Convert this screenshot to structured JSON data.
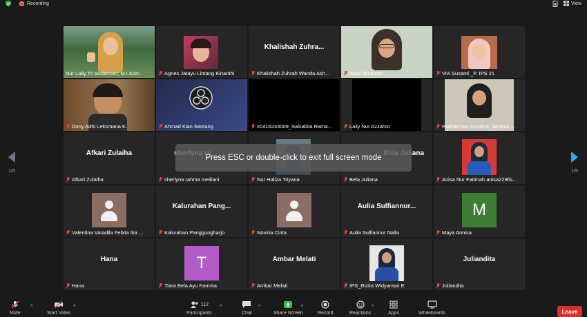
{
  "topbar": {
    "recording_label": "Recording",
    "view_label": "View"
  },
  "colors": {
    "active_speaker": "#a3d64a",
    "muted": "#e0453d",
    "leave": "#d9302c",
    "next_page": "#2fa6f4"
  },
  "toast": "Press ESC or double-click to exit full screen mode",
  "paging": {
    "left": "1/5",
    "right": "1/5"
  },
  "participants": [
    {
      "name": "Nur Laily Tri Wulansari, M.I.Kom",
      "video": "woman-thumbsup",
      "active": true,
      "muted": false
    },
    {
      "name": "Agnes Jatayu Lintang Kinanthi",
      "video": "woman-red",
      "muted": true
    },
    {
      "name": "Khalishah Zuhrah Wanda Ash...",
      "display": "Khalishah  Zuhra...",
      "muted": true
    },
    {
      "name": "nurul khotimah",
      "video": "woman-hijab-glasses",
      "muted": true
    },
    {
      "name": "Vivi Susanti _P. IPS 21",
      "video": "woman-pink-hijab",
      "muted": true
    },
    {
      "name": "Dony Adhi Leksmana K.",
      "video": "man-headset",
      "muted": true
    },
    {
      "name": "Ahmad Kian Santang",
      "video": "obs-logo",
      "muted": true
    },
    {
      "name": "20416244009_Salsabila Rama...",
      "video": "black",
      "muted": true
    },
    {
      "name": "Laily Nur Azzahro",
      "video": "black",
      "muted": true
    },
    {
      "name": "Fadhila Nur Azzahra_Septian ...",
      "video": "woman-dark-hijab",
      "muted": true
    },
    {
      "name": "Afkari Zulaiha",
      "display": "Afkari Zulaiha",
      "muted": true
    },
    {
      "name": "sherlyna rahma meiliani",
      "display": "sherlyna  ra",
      "muted": true
    },
    {
      "name": "Nur Haliza Triyana",
      "video": "small-photo",
      "muted": true
    },
    {
      "name": "Bela Juliana",
      "display": "Bela Juliana",
      "muted": true
    },
    {
      "name": "Anisa Nur Fatimah anisa229fis...",
      "video": "woman-red-bg",
      "muted": true
    },
    {
      "name": "Valentina Varadila Febita Ika ...",
      "avatar": "default",
      "muted": true
    },
    {
      "name": "Kalurahan Panggungharjo",
      "display": "Kalurahan  Pang...",
      "muted": true
    },
    {
      "name": "Noviria Cinta",
      "avatar": "default",
      "muted": true
    },
    {
      "name": "Aulia Sulfiannur Naila",
      "display": "Aulia  Sulfiannur...",
      "muted": true
    },
    {
      "name": "Maya Annisa",
      "avatar_letter": "M",
      "avatar_color": "#3e7d33",
      "muted": true
    },
    {
      "name": "Hana",
      "display": "Hana",
      "muted": true
    },
    {
      "name": "Tiara Bela Ayu Farmita",
      "avatar_letter": "T",
      "avatar_color": "#b45bc9",
      "muted": true
    },
    {
      "name": "Ambar Melati",
      "display": "Ambar Melati",
      "muted": true
    },
    {
      "name": "IPS_Rizka Widyantari E",
      "video": "woman-blue-hijab",
      "muted": true
    },
    {
      "name": "Juliandita",
      "display": "Juliandita",
      "muted": true
    }
  ],
  "toolbar": {
    "mute": "Mute",
    "start_video": "Start Video",
    "participants": "Participants",
    "participants_count": "112",
    "chat": "Chat",
    "share_screen": "Share Screen",
    "record": "Record",
    "reactions": "Reactions",
    "apps": "Apps",
    "whiteboards": "Whiteboards",
    "leave": "Leave"
  }
}
